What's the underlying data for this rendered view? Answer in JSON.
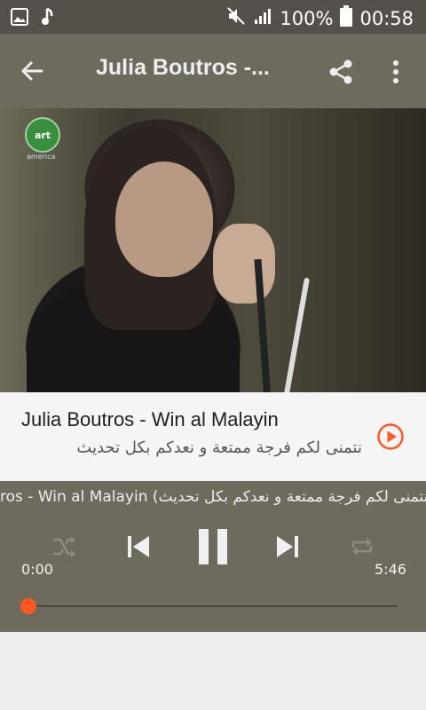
{
  "status_bar": {
    "battery": "100%",
    "time": "00:58"
  },
  "app_bar": {
    "title": "Julia Boutros -..."
  },
  "video": {
    "channel_logo": "art",
    "channel_sub": "america"
  },
  "track_info": {
    "title": "Julia Boutros - Win al Malayin",
    "subtitle": "نتمنى لكم فرجة ممتعة و نعدكم بكل تحديث"
  },
  "player": {
    "marquee": "ros - Win al Malayin (نتمنى لكم فرجة ممتعة و نعدكم بكل تحديث",
    "current_time": "0:00",
    "duration": "5:46",
    "progress": 0.0
  },
  "colors": {
    "accent": "#ff5722",
    "appbar": "#6f6a5e",
    "statusbar": "#55514a"
  }
}
